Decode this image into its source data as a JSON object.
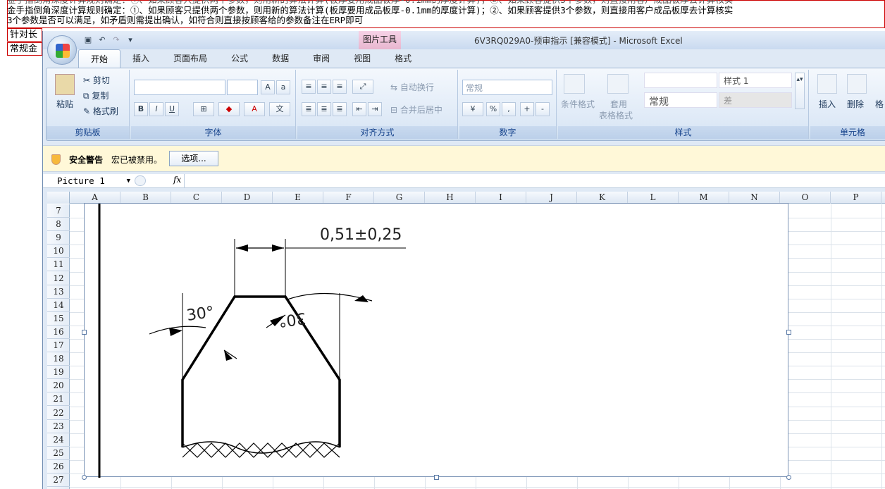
{
  "background_sheet": {
    "line1": "金手指倒角深度计算规则确定：①、如果顾客只提供两个参数，则用新的算法计算(板厚要用成品板厚-0.1mm的厚度计算)；②、如果顾客提供3个参数，则直接用客户成品板厚去计算核实",
    "line2": "3个参数是否可以满足，如矛盾则需提出确认，如符合则直接按顾客给的参数备注在ERP即可",
    "cell_left_1": "针对长",
    "cell_left_2": "常规金"
  },
  "window": {
    "title": "6V3RQ029A0-预审指示 [兼容模式] - Microsoft Excel",
    "context_tab": "图片工具"
  },
  "tabs": [
    "开始",
    "插入",
    "页面布局",
    "公式",
    "数据",
    "审阅",
    "视图",
    "格式"
  ],
  "ribbon": {
    "clipboard": {
      "paste": "粘贴",
      "cut": "剪切",
      "copy": "复制",
      "format_painter": "格式刷",
      "label": "剪贴板"
    },
    "font": {
      "label": "字体"
    },
    "alignment": {
      "wrap": "自动换行",
      "merge": "合并后居中",
      "label": "对齐方式"
    },
    "number": {
      "format": "常规",
      "label": "数字"
    },
    "styles": {
      "conditional": "条件格式",
      "table_line1": "套用",
      "table_line2": "表格格式",
      "style1": "样式 1",
      "normal": "常规",
      "bad": "差",
      "label": "样式"
    },
    "cells": {
      "insert": "插入",
      "delete": "删除",
      "format": "格",
      "label": "单元格"
    }
  },
  "security": {
    "title": "安全警告",
    "message": "宏已被禁用。",
    "options": "选项..."
  },
  "formula_bar": {
    "name_box": "Picture 1",
    "fx": "fx"
  },
  "columns": [
    "A",
    "B",
    "C",
    "D",
    "E",
    "F",
    "G",
    "H",
    "I",
    "J",
    "K",
    "L",
    "M",
    "N",
    "O",
    "P"
  ],
  "rows": [
    "7",
    "8",
    "9",
    "10",
    "11",
    "12",
    "13",
    "14",
    "15",
    "16",
    "17",
    "18",
    "19",
    "20",
    "21",
    "22",
    "23",
    "24",
    "25",
    "26",
    "27"
  ],
  "drawing": {
    "dimension": "0,51±0,25",
    "angle_left": "30°",
    "angle_right": "30°"
  }
}
